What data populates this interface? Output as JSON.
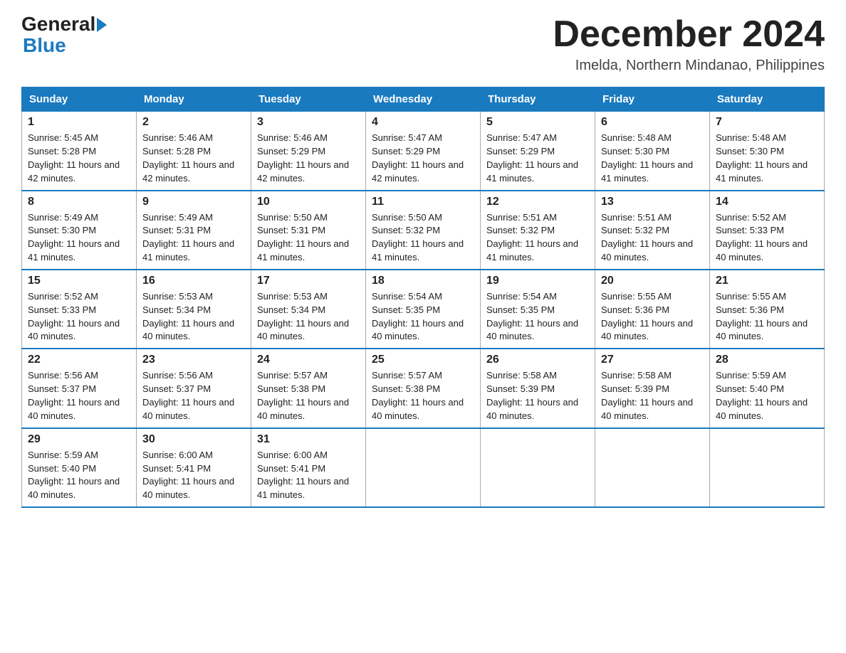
{
  "header": {
    "logo_general": "General",
    "logo_blue": "Blue",
    "month_title": "December 2024",
    "location": "Imelda, Northern Mindanao, Philippines"
  },
  "days_of_week": [
    "Sunday",
    "Monday",
    "Tuesday",
    "Wednesday",
    "Thursday",
    "Friday",
    "Saturday"
  ],
  "weeks": [
    [
      {
        "day": "1",
        "sunrise": "5:45 AM",
        "sunset": "5:28 PM",
        "daylight": "11 hours and 42 minutes."
      },
      {
        "day": "2",
        "sunrise": "5:46 AM",
        "sunset": "5:28 PM",
        "daylight": "11 hours and 42 minutes."
      },
      {
        "day": "3",
        "sunrise": "5:46 AM",
        "sunset": "5:29 PM",
        "daylight": "11 hours and 42 minutes."
      },
      {
        "day": "4",
        "sunrise": "5:47 AM",
        "sunset": "5:29 PM",
        "daylight": "11 hours and 42 minutes."
      },
      {
        "day": "5",
        "sunrise": "5:47 AM",
        "sunset": "5:29 PM",
        "daylight": "11 hours and 41 minutes."
      },
      {
        "day": "6",
        "sunrise": "5:48 AM",
        "sunset": "5:30 PM",
        "daylight": "11 hours and 41 minutes."
      },
      {
        "day": "7",
        "sunrise": "5:48 AM",
        "sunset": "5:30 PM",
        "daylight": "11 hours and 41 minutes."
      }
    ],
    [
      {
        "day": "8",
        "sunrise": "5:49 AM",
        "sunset": "5:30 PM",
        "daylight": "11 hours and 41 minutes."
      },
      {
        "day": "9",
        "sunrise": "5:49 AM",
        "sunset": "5:31 PM",
        "daylight": "11 hours and 41 minutes."
      },
      {
        "day": "10",
        "sunrise": "5:50 AM",
        "sunset": "5:31 PM",
        "daylight": "11 hours and 41 minutes."
      },
      {
        "day": "11",
        "sunrise": "5:50 AM",
        "sunset": "5:32 PM",
        "daylight": "11 hours and 41 minutes."
      },
      {
        "day": "12",
        "sunrise": "5:51 AM",
        "sunset": "5:32 PM",
        "daylight": "11 hours and 41 minutes."
      },
      {
        "day": "13",
        "sunrise": "5:51 AM",
        "sunset": "5:32 PM",
        "daylight": "11 hours and 40 minutes."
      },
      {
        "day": "14",
        "sunrise": "5:52 AM",
        "sunset": "5:33 PM",
        "daylight": "11 hours and 40 minutes."
      }
    ],
    [
      {
        "day": "15",
        "sunrise": "5:52 AM",
        "sunset": "5:33 PM",
        "daylight": "11 hours and 40 minutes."
      },
      {
        "day": "16",
        "sunrise": "5:53 AM",
        "sunset": "5:34 PM",
        "daylight": "11 hours and 40 minutes."
      },
      {
        "day": "17",
        "sunrise": "5:53 AM",
        "sunset": "5:34 PM",
        "daylight": "11 hours and 40 minutes."
      },
      {
        "day": "18",
        "sunrise": "5:54 AM",
        "sunset": "5:35 PM",
        "daylight": "11 hours and 40 minutes."
      },
      {
        "day": "19",
        "sunrise": "5:54 AM",
        "sunset": "5:35 PM",
        "daylight": "11 hours and 40 minutes."
      },
      {
        "day": "20",
        "sunrise": "5:55 AM",
        "sunset": "5:36 PM",
        "daylight": "11 hours and 40 minutes."
      },
      {
        "day": "21",
        "sunrise": "5:55 AM",
        "sunset": "5:36 PM",
        "daylight": "11 hours and 40 minutes."
      }
    ],
    [
      {
        "day": "22",
        "sunrise": "5:56 AM",
        "sunset": "5:37 PM",
        "daylight": "11 hours and 40 minutes."
      },
      {
        "day": "23",
        "sunrise": "5:56 AM",
        "sunset": "5:37 PM",
        "daylight": "11 hours and 40 minutes."
      },
      {
        "day": "24",
        "sunrise": "5:57 AM",
        "sunset": "5:38 PM",
        "daylight": "11 hours and 40 minutes."
      },
      {
        "day": "25",
        "sunrise": "5:57 AM",
        "sunset": "5:38 PM",
        "daylight": "11 hours and 40 minutes."
      },
      {
        "day": "26",
        "sunrise": "5:58 AM",
        "sunset": "5:39 PM",
        "daylight": "11 hours and 40 minutes."
      },
      {
        "day": "27",
        "sunrise": "5:58 AM",
        "sunset": "5:39 PM",
        "daylight": "11 hours and 40 minutes."
      },
      {
        "day": "28",
        "sunrise": "5:59 AM",
        "sunset": "5:40 PM",
        "daylight": "11 hours and 40 minutes."
      }
    ],
    [
      {
        "day": "29",
        "sunrise": "5:59 AM",
        "sunset": "5:40 PM",
        "daylight": "11 hours and 40 minutes."
      },
      {
        "day": "30",
        "sunrise": "6:00 AM",
        "sunset": "5:41 PM",
        "daylight": "11 hours and 40 minutes."
      },
      {
        "day": "31",
        "sunrise": "6:00 AM",
        "sunset": "5:41 PM",
        "daylight": "11 hours and 41 minutes."
      },
      null,
      null,
      null,
      null
    ]
  ]
}
